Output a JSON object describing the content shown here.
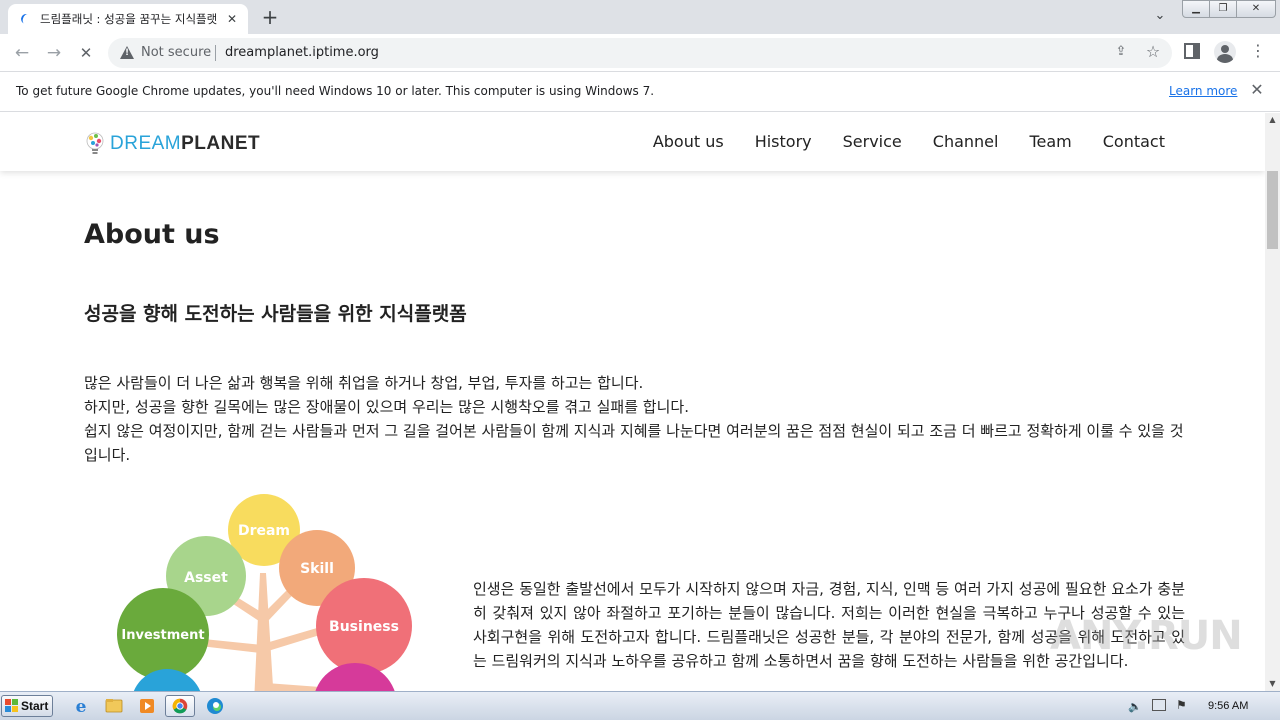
{
  "browser": {
    "tab_title": "드림플래닛 : 성공을 꿈꾸는 지식플랫",
    "tab_close": "✕",
    "new_tab": "+",
    "not_secure": "Not secure",
    "url": "dreamplanet.iptime.org"
  },
  "infobar": {
    "message": "To get future Google Chrome updates, you'll need Windows 10 or later. This computer is using Windows 7.",
    "link": "Learn more"
  },
  "site": {
    "logo_dream": "DREAM",
    "logo_planet": "PLANET",
    "nav": [
      "About us",
      "History",
      "Service",
      "Channel",
      "Team",
      "Contact"
    ]
  },
  "main": {
    "title": "About us",
    "subtitle": "성공을 향해 도전하는 사람들을 위한 지식플랫폼",
    "paragraph": [
      "많은 사람들이 더 나은 삶과 행복을 위해 취업을 하거나 창업, 부업, 투자를 하고는 합니다.",
      "하지만, 성공을 향한 길목에는 많은 장애물이 있으며 우리는 많은 시행착오를 겪고 실패를 합니다.",
      "쉽지 않은 여정이지만, 함께 걷는 사람들과 먼저 그 길을 걸어본 사람들이 함께 지식과 지혜를 나눈다면 여러분의 꿈은 점점 현실이 되고 조금 더 빠르고 정확하게 이룰 수 있을 것입니다."
    ],
    "diagram_labels": {
      "dream": "Dream",
      "asset": "Asset",
      "skill": "Skill",
      "investment": "Investment",
      "business": "Business"
    },
    "right_paragraph": "인생은 동일한 출발선에서 모두가 시작하지 않으며 자금, 경험, 지식, 인맥 등 여러 가지 성공에 필요한 요소가 충분히 갖춰져 있지 않아 좌절하고 포기하는 분들이 많습니다. 저희는 이러한 현실을 극복하고 누구나 성공할 수 있는 사회구현을 위해 도전하고자 합니다. 드림플래닛은 성공한 분들, 각 분야의 전문가, 함께 성공을 위해 도전하고 있는 드림워커의 지식과 노하우를 공유하고 함께 소통하면서 꿈을 향해 도전하는 사람들을 위한 공간입니다."
  },
  "watermark": "ANY.RUN",
  "taskbar": {
    "start": "Start",
    "clock": "9:56 AM"
  },
  "colors": {
    "dream": "#f8dc5e",
    "asset": "#a8d58c",
    "skill": "#f2a97a",
    "investment": "#6aaa3c",
    "business": "#f07078",
    "branch": "#f6c9a8",
    "logo_blue": "#29a3d9"
  }
}
